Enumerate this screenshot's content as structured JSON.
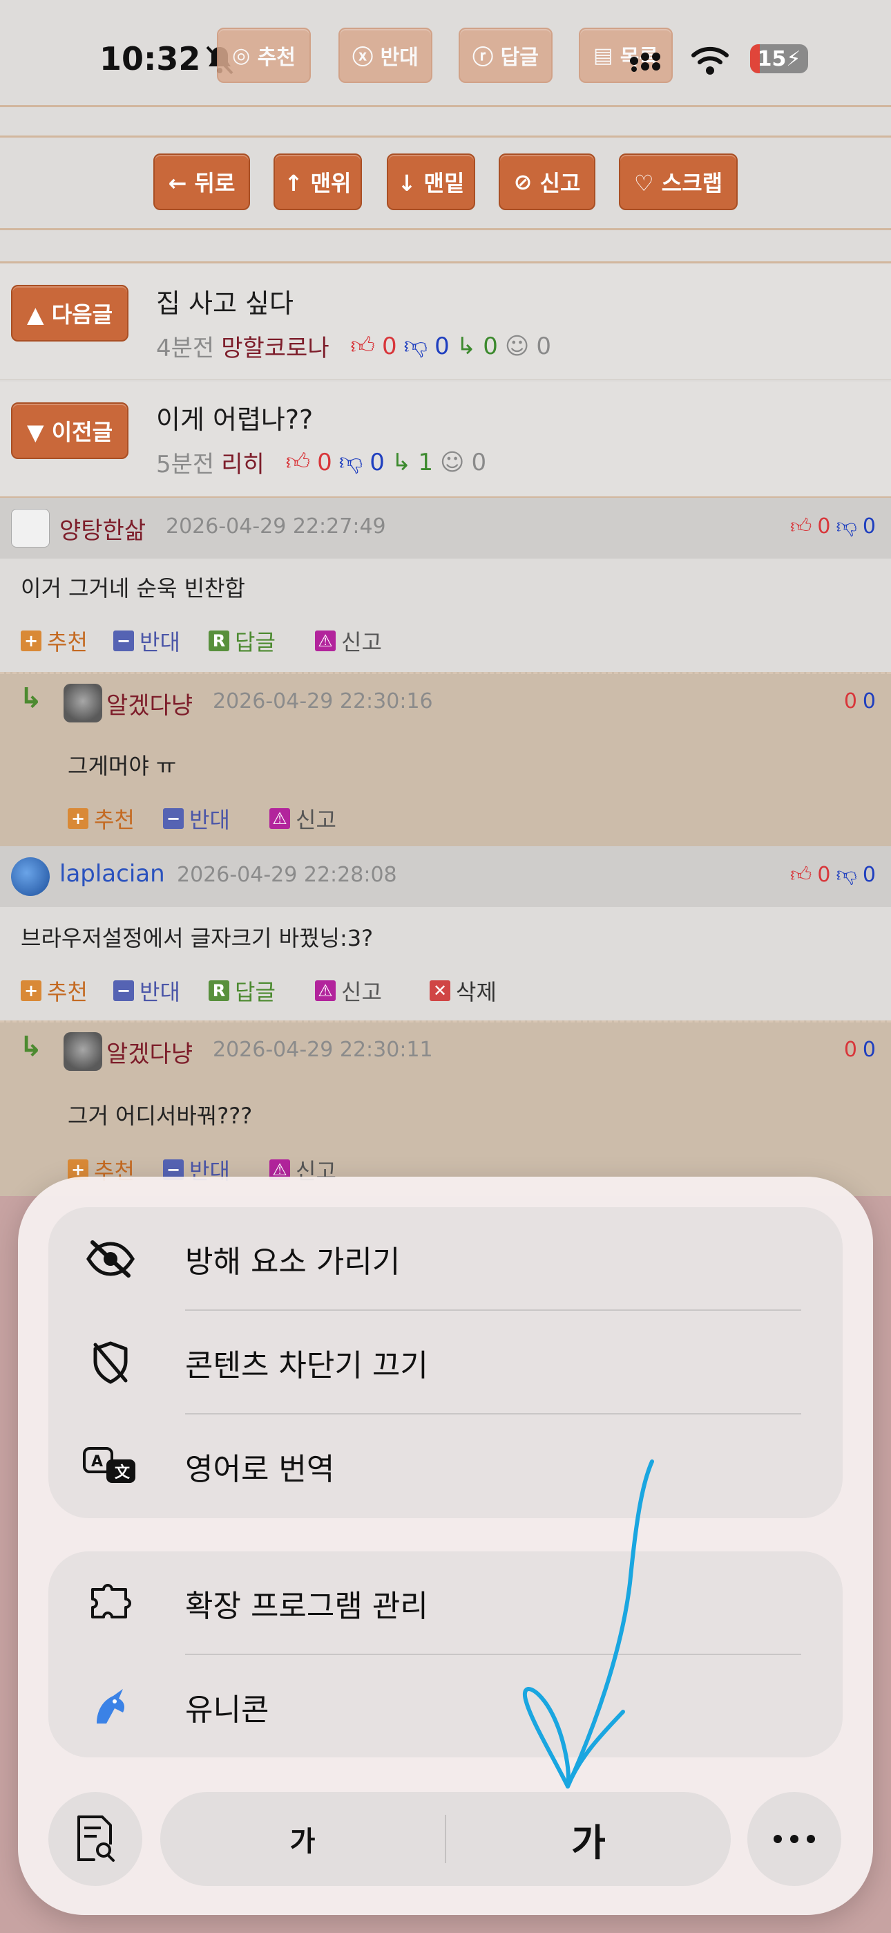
{
  "status_bar": {
    "time": "10:32",
    "battery": "15"
  },
  "top_actions": [
    "추천",
    "반대",
    "답글",
    "목록"
  ],
  "nav_buttons": [
    "← 뒤로",
    "↑ 맨위",
    "↓ 맨밑",
    "신고",
    "♡ 스크랩"
  ],
  "next_post": {
    "button": "▲ 다음글",
    "title": "집 사고 싶다",
    "time": "4분전",
    "author": "망할코로나",
    "up": "0",
    "down": "0",
    "replies": "0",
    "views": "0"
  },
  "prev_post": {
    "button": "▼ 이전글",
    "title": "이게 어렵나??",
    "time": "5분전",
    "author": "리히",
    "up": "0",
    "down": "0",
    "replies": "1",
    "views": "0"
  },
  "comments": [
    {
      "author": "양탕한삶",
      "date": "2026-04-29 22:27:49",
      "up": "0",
      "down": "0",
      "text": "이거 그거네 순욱 빈찬합",
      "actions": {
        "recommend": "추천",
        "oppose": "반대",
        "reply": "답글",
        "report": "신고"
      }
    },
    {
      "author": "알겠다냥",
      "date": "2026-04-29 22:30:16",
      "up": "0",
      "down": "0",
      "text": "그게머야 ㅠ",
      "actions": {
        "recommend": "추천",
        "oppose": "반대",
        "report": "신고"
      }
    },
    {
      "author": "laplacian",
      "date": "2026-04-29 22:28:08",
      "up": "0",
      "down": "0",
      "text": "브라우저설정에서 글자크기 바꿨닝:3?",
      "actions": {
        "recommend": "추천",
        "oppose": "반대",
        "reply": "답글",
        "report": "신고",
        "delete": "삭제"
      }
    },
    {
      "author": "알겠다냥",
      "date": "2026-04-29 22:30:11",
      "up": "0",
      "down": "0",
      "text": "그거 어디서바꿔???",
      "actions": {
        "recommend": "추천",
        "oppose": "반대",
        "report": "신고"
      }
    }
  ],
  "sheet": {
    "group1": [
      "방해 요소 가리기",
      "콘텐츠 차단기 끄기",
      "영어로 번역"
    ],
    "group2": [
      "확장 프로그램 관리",
      "유니콘"
    ],
    "font_small": "가",
    "font_large": "가"
  },
  "colors": {
    "accent_orange": "#c9683a",
    "annotation_stroke": "#1aa6e0"
  }
}
